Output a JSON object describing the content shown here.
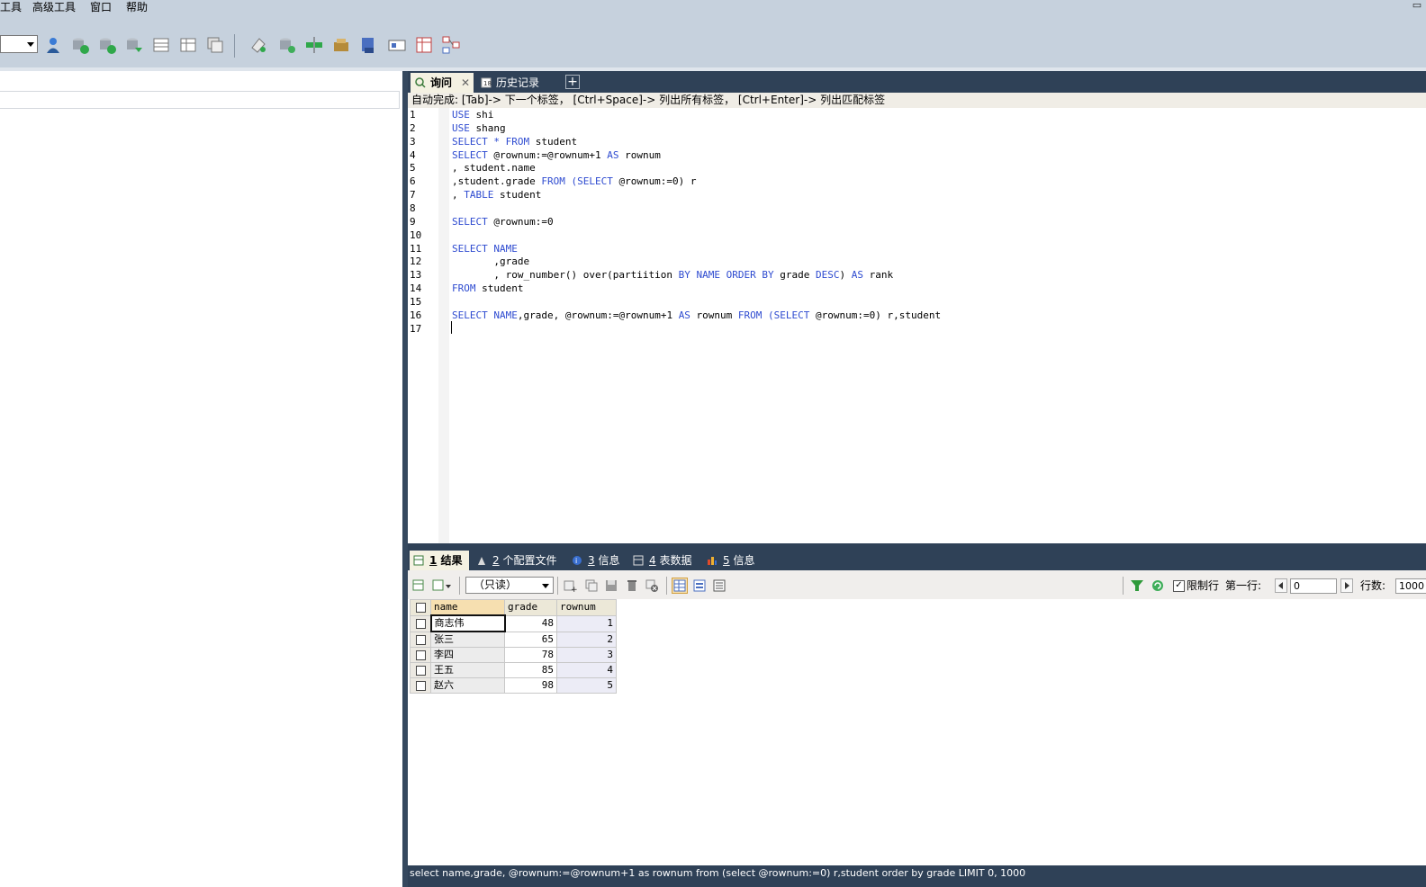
{
  "menu": {
    "tools": "工具",
    "advanced_tools": "高级工具",
    "window": "窗口",
    "help": "帮助"
  },
  "query_tabs": {
    "query": "询问",
    "history": "历史记录",
    "add": "+"
  },
  "hint": "自动完成: [Tab]-> 下一个标签， [Ctrl+Space]-> 列出所有标签， [Ctrl+Enter]-> 列出匹配标签",
  "editor": {
    "line_numbers": [
      "1",
      "2",
      "3",
      "4",
      "5",
      "6",
      "7",
      "8",
      "9",
      "10",
      "11",
      "12",
      "13",
      "14",
      "15",
      "16",
      "17"
    ],
    "lines": [
      [
        {
          "t": "USE",
          "k": true
        },
        {
          "t": " shi"
        }
      ],
      [
        {
          "t": "USE",
          "k": true
        },
        {
          "t": " shang"
        }
      ],
      [
        {
          "t": "SELECT",
          "k": true
        },
        {
          "t": " "
        },
        {
          "t": "*",
          "k": true
        },
        {
          "t": " "
        },
        {
          "t": "FROM",
          "k": true
        },
        {
          "t": " student"
        }
      ],
      [
        {
          "t": "SELECT",
          "k": true
        },
        {
          "t": " @rownum:=@rownum+1 "
        },
        {
          "t": "AS",
          "k": true
        },
        {
          "t": " rownum"
        }
      ],
      [
        {
          "t": ", student.name"
        }
      ],
      [
        {
          "t": ",student.grade "
        },
        {
          "t": "FROM",
          "k": true
        },
        {
          "t": " "
        },
        {
          "t": "(SELECT",
          "k": true
        },
        {
          "t": " @rownum:=0) r"
        }
      ],
      [
        {
          "t": ", "
        },
        {
          "t": "TABLE",
          "k": true
        },
        {
          "t": " student"
        }
      ],
      [],
      [
        {
          "t": "SELECT",
          "k": true
        },
        {
          "t": " @rownum:=0"
        }
      ],
      [],
      [
        {
          "t": "SELECT",
          "k": true
        },
        {
          "t": " "
        },
        {
          "t": "NAME",
          "k": true
        }
      ],
      [
        {
          "t": "       ,grade"
        }
      ],
      [
        {
          "t": "       , row_number() over(partiition "
        },
        {
          "t": "BY",
          "k": true
        },
        {
          "t": " "
        },
        {
          "t": "NAME",
          "k": true
        },
        {
          "t": " "
        },
        {
          "t": "ORDER",
          "k": true
        },
        {
          "t": " "
        },
        {
          "t": "BY",
          "k": true
        },
        {
          "t": " grade "
        },
        {
          "t": "DESC",
          "k": true
        },
        {
          "t": ") "
        },
        {
          "t": "AS",
          "k": true
        },
        {
          "t": " rank"
        }
      ],
      [
        {
          "t": "FROM",
          "k": true
        },
        {
          "t": " student"
        }
      ],
      [],
      [
        {
          "t": "SELECT",
          "k": true
        },
        {
          "t": " "
        },
        {
          "t": "NAME",
          "k": true
        },
        {
          "t": ",grade, @rownum:=@rownum+1 "
        },
        {
          "t": "AS",
          "k": true
        },
        {
          "t": " rownum "
        },
        {
          "t": "FROM",
          "k": true
        },
        {
          "t": " "
        },
        {
          "t": "(SELECT",
          "k": true
        },
        {
          "t": " @rownum:=0) r,student"
        }
      ],
      []
    ]
  },
  "result_tabs": [
    {
      "num": "1",
      "label": " 结果"
    },
    {
      "num": "2",
      "label": " 个配置文件"
    },
    {
      "num": "3",
      "label": " 信息"
    },
    {
      "num": "4",
      "label": " 表数据"
    },
    {
      "num": "5",
      "label": " 信息"
    }
  ],
  "result_toolbar": {
    "readonly": "（只读）",
    "limit_rows": "限制行",
    "first_row_label": "第一行:",
    "first_row_value": "0",
    "rows_label": "行数:",
    "rows_value": "1000"
  },
  "grid": {
    "columns": [
      "name",
      "grade",
      "rownum"
    ],
    "rows": [
      {
        "name": "商志伟",
        "grade": "48",
        "rownum": "1"
      },
      {
        "name": "张三",
        "grade": "65",
        "rownum": "2"
      },
      {
        "name": "李四",
        "grade": "78",
        "rownum": "3"
      },
      {
        "name": "王五",
        "grade": "85",
        "rownum": "4"
      },
      {
        "name": "赵六",
        "grade": "98",
        "rownum": "5"
      }
    ]
  },
  "status": "select name,grade, @rownum:=@rownum+1 as rownum from (select @rownum:=0) r,student order by grade LIMIT 0, 1000",
  "colors": {
    "dark_panel": "#2f4157",
    "toolbar": "#c6d1dd",
    "keyword": "#2e4bd0"
  }
}
